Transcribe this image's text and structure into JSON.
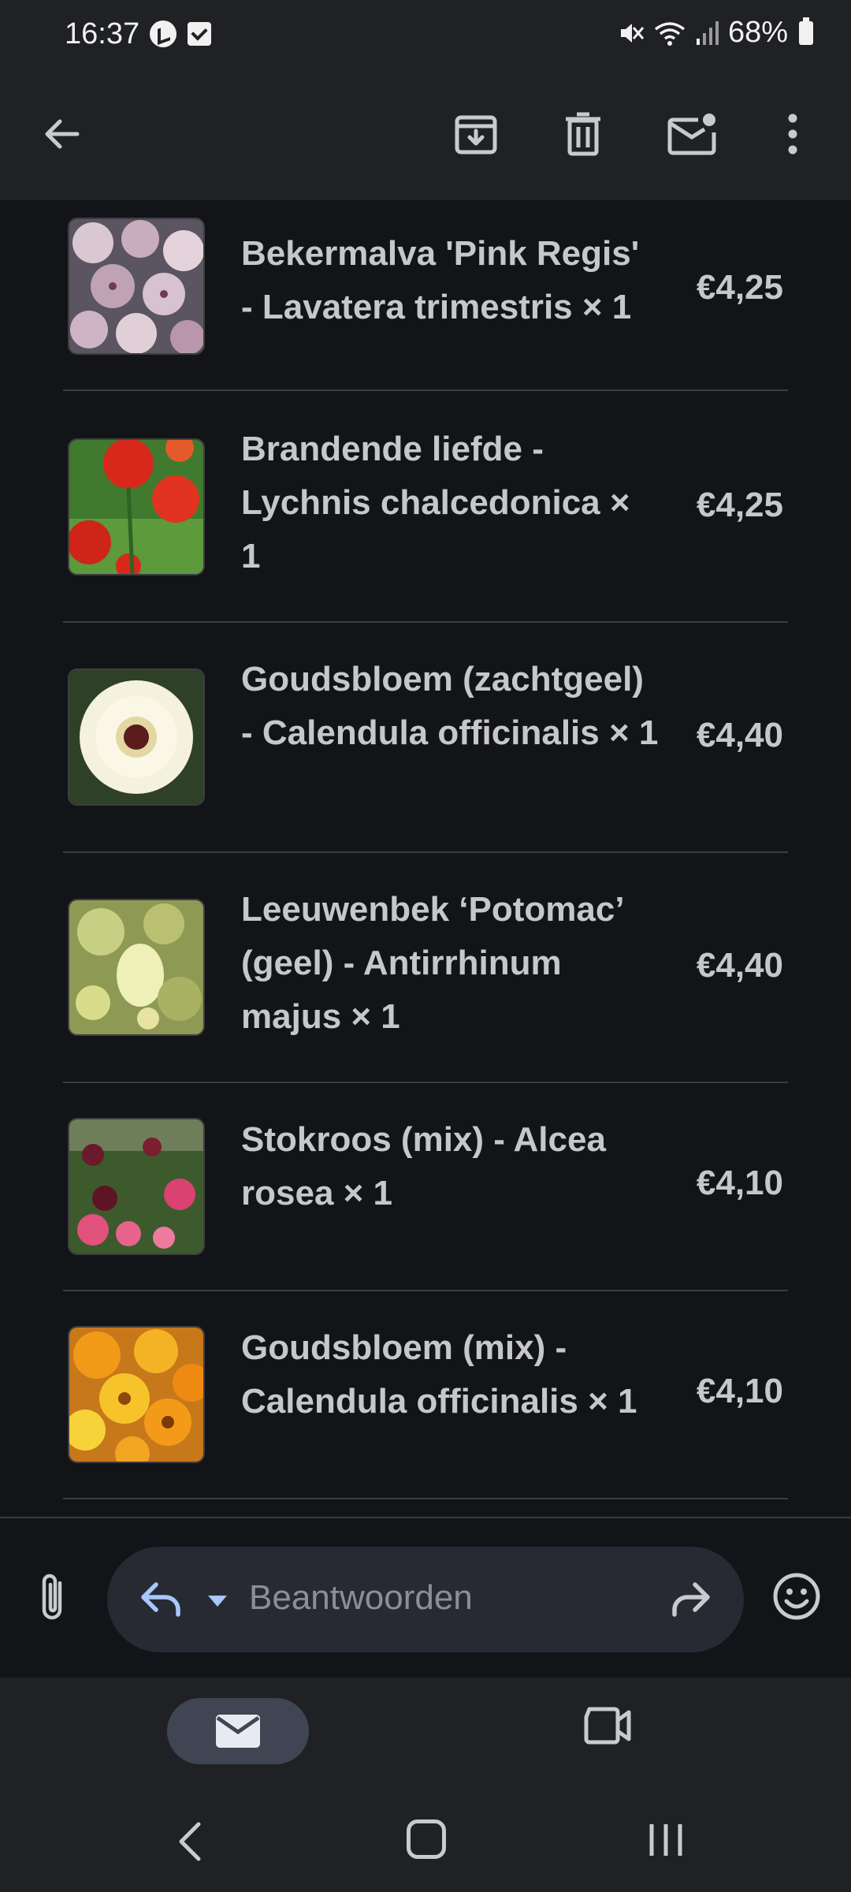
{
  "status_bar": {
    "time": "16:37",
    "battery": "68%",
    "icons": [
      "alarm-status-icon",
      "check-status-icon",
      "mute-icon",
      "wifi-icon",
      "signal-icon",
      "battery-icon"
    ]
  },
  "toolbar": {
    "icons": [
      "back-arrow-icon",
      "archive-icon",
      "delete-icon",
      "mark-unread-icon",
      "more-vert-icon"
    ]
  },
  "order_items": [
    {
      "name": "Bekermalva 'Pink Regis' - Lavatera trimestris × 1",
      "price": "€4,25"
    },
    {
      "name": "Brandende liefde - Lychnis chalcedonica × 1",
      "price": "€4,25"
    },
    {
      "name": "Goudsbloem (zachtgeel) - Calendula officinalis × 1",
      "price": "€4,40"
    },
    {
      "name": "Leeuwenbek ‘Potomac’ (geel) - Antirrhinum majus × 1",
      "price": "€4,40"
    },
    {
      "name": "Stokroos (mix) - Alcea rosea × 1",
      "price": "€4,10"
    },
    {
      "name": "Goudsbloem (mix) - Calendula officinalis × 1",
      "price": "€4,10"
    }
  ],
  "reply": {
    "placeholder": "Beantwoorden"
  },
  "colors": {
    "background": "#131417",
    "bar": "#202124",
    "pill": "#282a33",
    "accent": "#a8c7fa"
  }
}
